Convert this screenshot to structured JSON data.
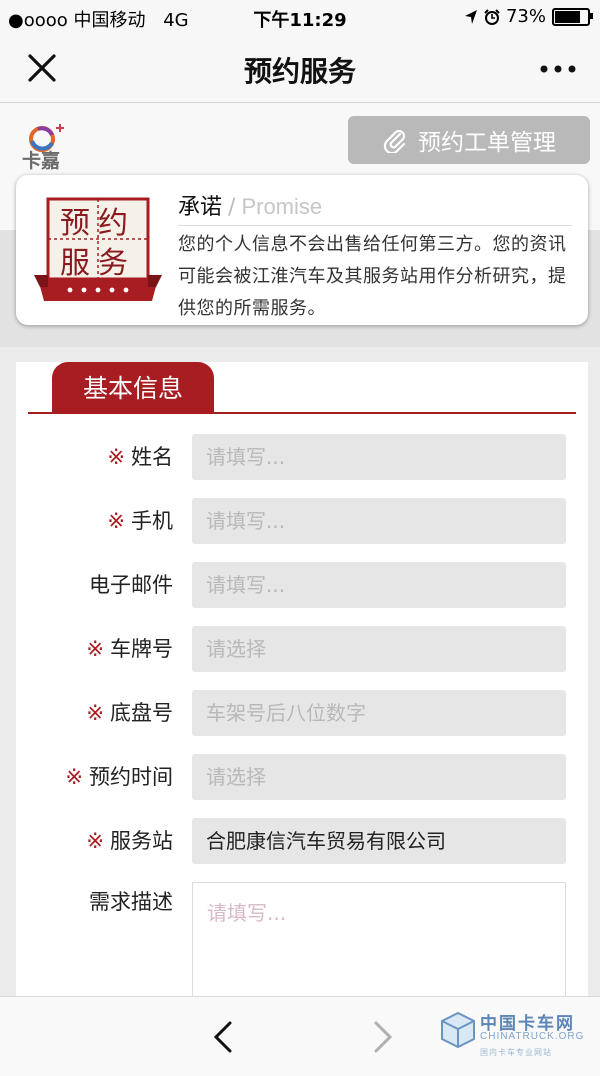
{
  "status_bar": {
    "signal": "●oooo 中国移动",
    "network": "4G",
    "time": "下午11:29",
    "battery": "73%",
    "battery_level": 0.73
  },
  "nav": {
    "title": "预约服务",
    "close_icon": "close-icon",
    "more_icon": "more-icon"
  },
  "header": {
    "logo_text": "卡嘉",
    "manage_button": "预约工单管理"
  },
  "promise": {
    "badge_top": "预约",
    "badge_bottom": "服务",
    "title": "承诺",
    "separator": "/",
    "title_en": "Promise",
    "text": "您的个人信息不会出售给任何第三方。您的资讯可能会被江淮汽车及其服务站用作分析研究，提供您的所需服务。"
  },
  "form": {
    "section_title": "基本信息",
    "required_mark": "※",
    "fields": [
      {
        "label": "姓名",
        "required": true,
        "placeholder": "请填写..."
      },
      {
        "label": "手机",
        "required": true,
        "placeholder": "请填写..."
      },
      {
        "label": "电子邮件",
        "required": false,
        "placeholder": "请填写..."
      },
      {
        "label": "车牌号",
        "required": true,
        "placeholder": "请选择"
      },
      {
        "label": "底盘号",
        "required": true,
        "placeholder": "车架号后八位数字"
      },
      {
        "label": "预约时间",
        "required": true,
        "placeholder": "请选择"
      },
      {
        "label": "服务站",
        "required": true,
        "value": "合肥康信汽车贸易有限公司"
      }
    ],
    "description": {
      "label": "需求描述",
      "placeholder": "请填写..."
    }
  },
  "bottom": {
    "watermark_cn": "中国卡车网",
    "watermark_en": "CHINATRUCK.ORG",
    "watermark_sub": "国内卡车专业网站"
  }
}
